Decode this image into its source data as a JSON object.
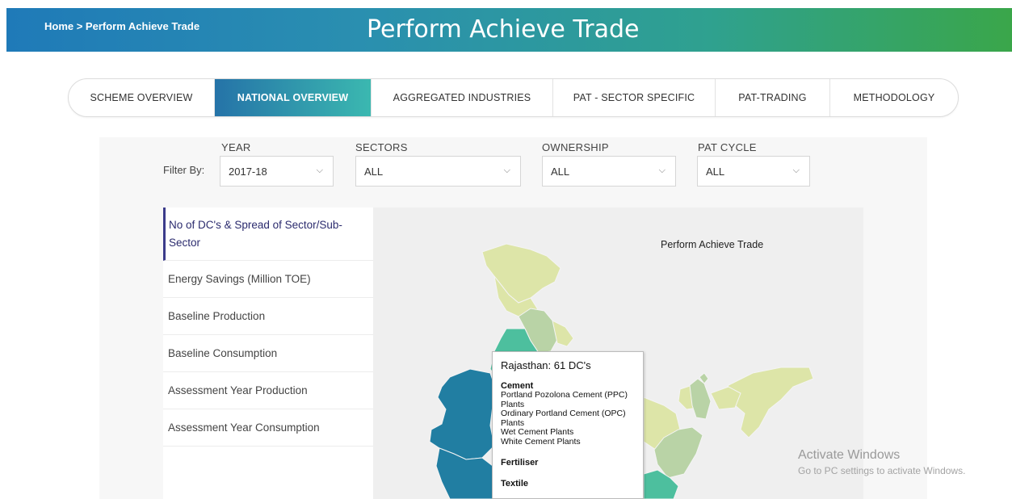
{
  "header": {
    "breadcrumb": "Home > Perform Achieve Trade",
    "title": "Perform Achieve Trade"
  },
  "tabs": [
    {
      "label": "SCHEME OVERVIEW",
      "active": false
    },
    {
      "label": "NATIONAL OVERVIEW",
      "active": true
    },
    {
      "label": "AGGREGATED INDUSTRIES",
      "active": false
    },
    {
      "label": "PAT - SECTOR SPECIFIC",
      "active": false
    },
    {
      "label": "PAT-TRADING",
      "active": false
    },
    {
      "label": "METHODOLOGY",
      "active": false
    }
  ],
  "filters": {
    "label": "Filter By:",
    "year": {
      "label": "YEAR",
      "value": "2017-18"
    },
    "sectors": {
      "label": "SECTORS",
      "value": "ALL"
    },
    "ownership": {
      "label": "OWNERSHIP",
      "value": "ALL"
    },
    "pat_cycle": {
      "label": "PAT CYCLE",
      "value": "ALL"
    }
  },
  "metrics": [
    {
      "label": "No of DC's & Spread of Sector/Sub-Sector",
      "active": true
    },
    {
      "label": "Energy Savings (Million TOE)",
      "active": false
    },
    {
      "label": "Baseline Production",
      "active": false
    },
    {
      "label": "Baseline Consumption",
      "active": false
    },
    {
      "label": "Assessment Year Production",
      "active": false
    },
    {
      "label": "Assessment Year Consumption",
      "active": false
    }
  ],
  "map": {
    "title": "Perform Achieve Trade",
    "colors": {
      "light": "#dde5a8",
      "mid": "#b9d3a6",
      "teal": "#4dbf9e",
      "dark": "#217ea2"
    }
  },
  "tooltip": {
    "title": "Rajasthan: 61 DC's",
    "sector1": "Cement",
    "sub1": "Portland Pozolona Cement (PPC) Plants",
    "sub2": "Ordinary Portland Cement (OPC) Plants",
    "sub3": "Wet Cement Plants",
    "sub4": "White Cement Plants",
    "sector2": "Fertiliser",
    "sector3": "Textile"
  },
  "watermark": {
    "title": "Activate Windows",
    "subtitle": "Go to PC settings to activate Windows."
  }
}
